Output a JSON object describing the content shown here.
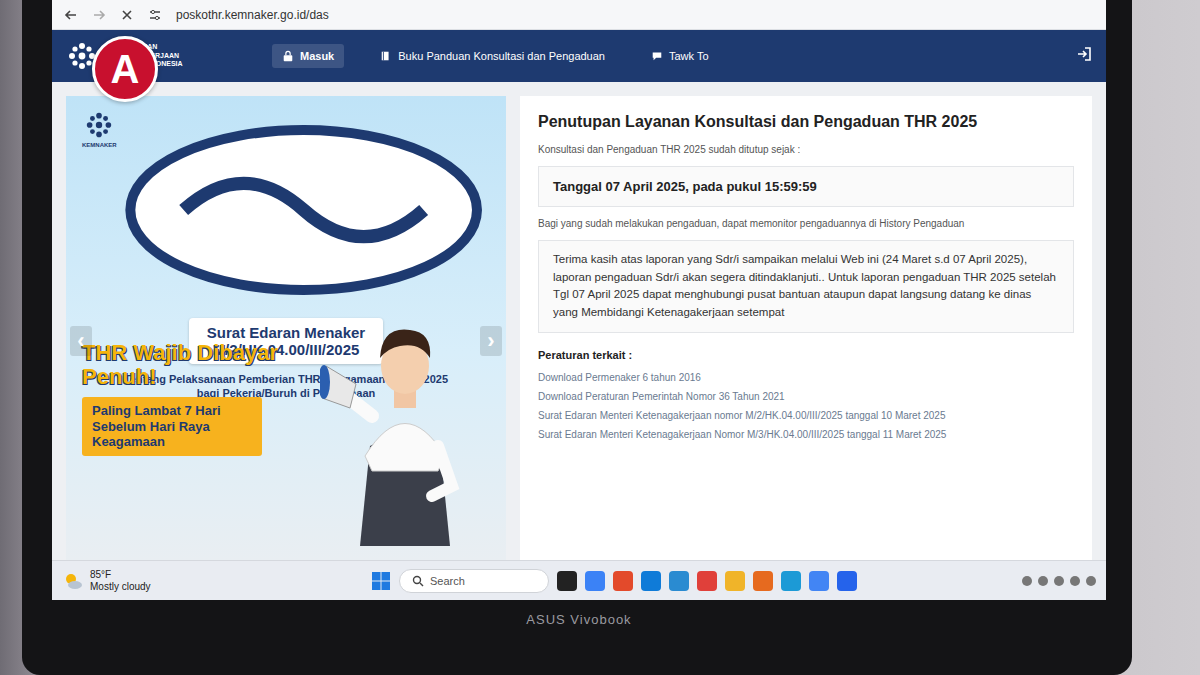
{
  "watermark": {
    "label": "A"
  },
  "browser": {
    "url": "poskothr.kemnaker.go.id/das"
  },
  "nav": {
    "brand": [
      "KEMENTERIAN",
      "KETENAGAKERJAAN",
      "REPUBLIK INDONESIA"
    ],
    "items": [
      {
        "label": "Masuk",
        "selected": true
      },
      {
        "label": "Buku Panduan Konsultasi dan Pengaduan",
        "selected": false
      },
      {
        "label": "Tawk To",
        "selected": false
      }
    ]
  },
  "banner": {
    "org": "KEMNAKER",
    "title": "Surat Edaran Menaker",
    "code": "M/2/HK.04.00/III/2025",
    "subtitle": "Tentang Pelaksanaan Pemberian THR Keagamaan Tahun 2025 bagi Pekerja/Buruh di Perusahaan",
    "headline": "THR Wajib Dibayar Penuh!",
    "deadline": "Paling Lambat 7 Hari Sebelum Hari Raya Keagamaan",
    "prev": "‹",
    "next": "›"
  },
  "panel": {
    "title": "Penutupan Layanan Konsultasi dan Pengaduan THR 2025",
    "closed_note": "Konsultasi dan Pengaduan THR 2025 sudah ditutup sejak :",
    "date": "Tanggal 07 April 2025, pada pukul 15:59:59",
    "monitor_note": "Bagi yang sudah melakukan pengaduan, dapat memonitor pengaduannya di History Pengaduan",
    "message": "Terima kasih atas laporan yang Sdr/i sampaikan melalui Web ini (24 Maret s.d 07 April 2025), laporan pengaduan Sdr/i akan segera ditindaklanjuti.. Untuk laporan pengaduan THR 2025 setelah Tgl 07 April 2025 dapat menghubungi pusat bantuan ataupun dapat langsung datang ke dinas yang Membidangi Ketenagakerjaan setempat",
    "regs_title": "Peraturan terkait :",
    "regs": [
      "Download Permenaker 6 tahun 2016",
      "Download Peraturan Pemerintah Nomor 36 Tahun 2021",
      "Surat Edaran Menteri Ketenagakerjaan nomor M/2/HK.04.00/III/2025 tanggal 10 Maret 2025",
      "Surat Edaran Menteri Ketenagakerjaan Nomor M/3/HK.04.00/III/2025 tanggal 11 Maret 2025"
    ]
  },
  "taskbar": {
    "temp": "85°F",
    "condition": "Mostly cloudy",
    "search": "Search"
  },
  "laptop": {
    "brand": "ASUS Vivobook"
  }
}
